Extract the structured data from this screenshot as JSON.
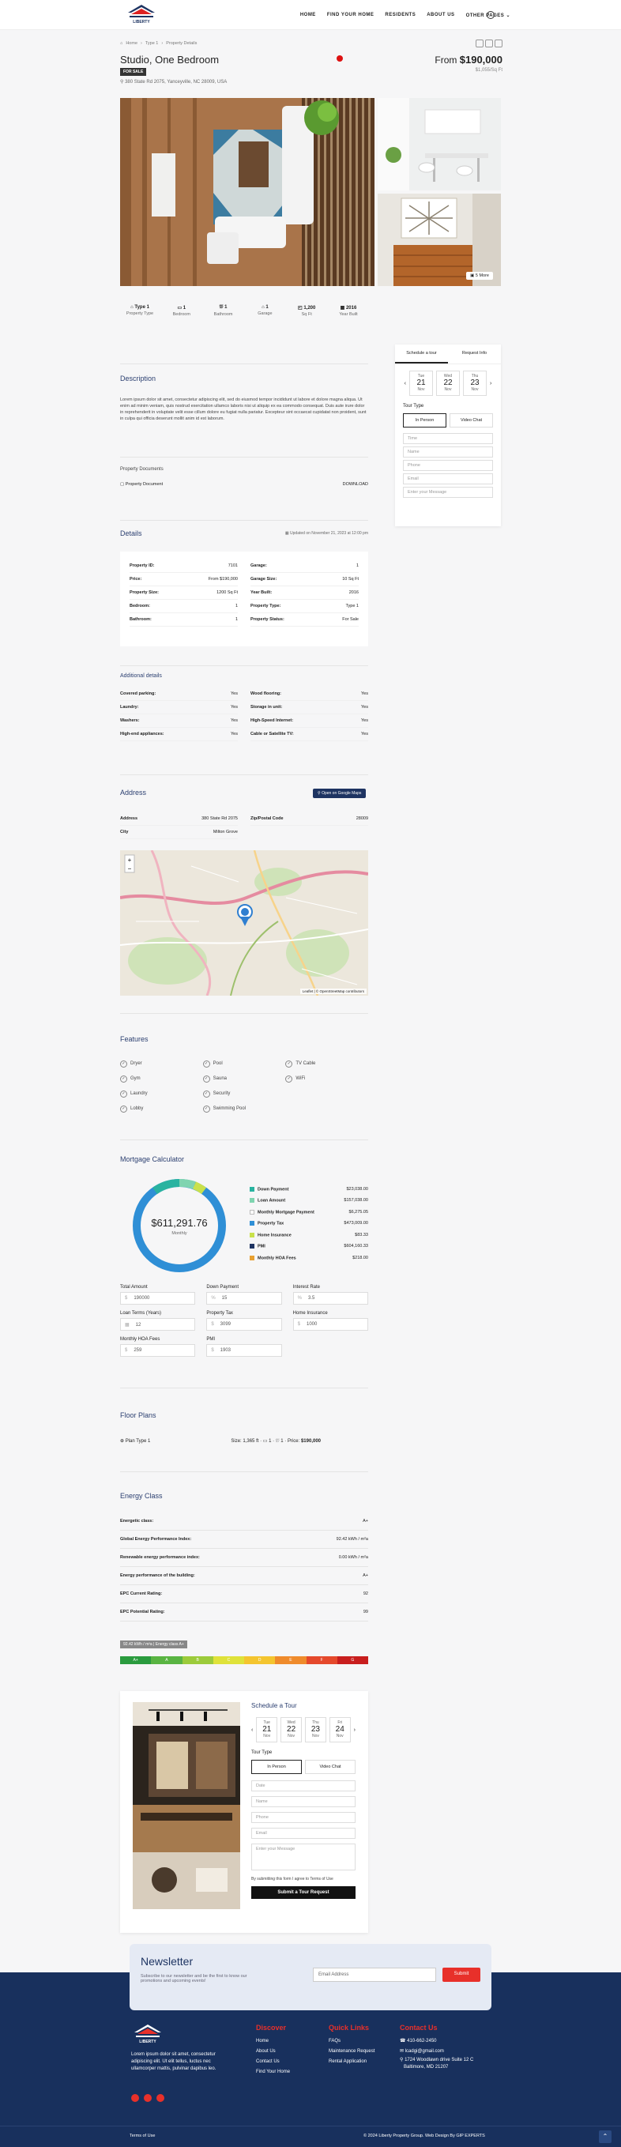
{
  "header": {
    "logo_text": "LIBERTY",
    "nav": [
      "HOME",
      "FIND YOUR HOME",
      "RESIDENTS",
      "ABOUT US",
      "OTHER PAGES"
    ]
  },
  "breadcrumb": [
    "Home",
    "Type 1",
    "Property Details"
  ],
  "property": {
    "title": "Studio, One Bedroom",
    "badge": "FOR SALE",
    "address": "380 State Rd 2075, Yanceyville, NC 28009, USA",
    "price_prefix": "From",
    "price": "$190,000",
    "price_sub": "$1,055/Sq Ft",
    "more_photos": "5 More"
  },
  "facts": [
    {
      "v": "Type 1",
      "l": "Property Type"
    },
    {
      "v": "1",
      "l": "Bedroom"
    },
    {
      "v": "1",
      "l": "Bathroom"
    },
    {
      "v": "1",
      "l": "Garage"
    },
    {
      "v": "1,200",
      "l": "Sq Ft"
    },
    {
      "v": "2016",
      "l": "Year Built"
    }
  ],
  "sidebar": {
    "tab1": "Schedule a tour",
    "tab2": "Request Info",
    "days": [
      {
        "d": "Tue",
        "n": "21",
        "m": "Nov"
      },
      {
        "d": "Wed",
        "n": "22",
        "m": "Nov"
      },
      {
        "d": "Thu",
        "n": "23",
        "m": "Nov"
      }
    ],
    "tour_type": "Tour Type",
    "in_person": "In Person",
    "video": "Video Chat",
    "fields": [
      "Time",
      "Name",
      "Phone",
      "Email",
      "Enter your Message"
    ]
  },
  "description": {
    "heading": "Description",
    "text": "Lorem ipsum dolor sit amet, consectetur adipiscing elit, sed do eiusmod tempor incididunt ut labore et dolore magna aliqua. Ut enim ad minim veniam, quis nostrud exercitation ullamco laboris nisi ut aliquip ex ea commodo consequat. Duis aute irure dolor in reprehenderit in voluptate velit esse cillum dolore eu fugiat nulla pariatur. Excepteur sint occaecat cupidatat non proident, sunt in culpa qui officia deserunt mollit anim id est laborum.",
    "docs_heading": "Property Documents",
    "doc_name": "Property Document",
    "download": "DOWNLOAD"
  },
  "details": {
    "heading": "Details",
    "updated": "Updated on November 21, 2023 at 12:00 pm",
    "left": [
      [
        "Property ID:",
        "7101"
      ],
      [
        "Price:",
        "From $190,000"
      ],
      [
        "Property Size:",
        "1200 Sq Ft"
      ],
      [
        "Bedroom:",
        "1"
      ],
      [
        "Bathroom:",
        "1"
      ]
    ],
    "right": [
      [
        "Garage:",
        "1"
      ],
      [
        "Garage Size:",
        "10 Sq Ft"
      ],
      [
        "Year Built:",
        "2016"
      ],
      [
        "Property Type:",
        "Type 1"
      ],
      [
        "Property Status:",
        "For Sale"
      ]
    ]
  },
  "additional": {
    "heading": "Additional details",
    "left": [
      [
        "Covered parking:",
        "Yes"
      ],
      [
        "Laundry:",
        "Yes"
      ],
      [
        "Washers:",
        "Yes"
      ],
      [
        "High-end appliances:",
        "Yes"
      ]
    ],
    "right": [
      [
        "Wood flooring:",
        "Yes"
      ],
      [
        "Storage in unit:",
        "Yes"
      ],
      [
        "High-Speed Internet:",
        "Yes"
      ],
      [
        "Cable or Satellite TV:",
        "Yes"
      ]
    ]
  },
  "address_sec": {
    "heading": "Address",
    "button": "Open on Google Maps",
    "rows": [
      [
        "Address",
        "380 State Rd 2075",
        "Zip/Postal Code",
        "28009"
      ],
      [
        "City",
        "Milton Grove",
        "",
        ""
      ]
    ],
    "map_credit": "Leaflet | © OpenStreetMap contributors"
  },
  "features": {
    "heading": "Features",
    "items": [
      "Dryer",
      "Pool",
      "TV Cable",
      "Gym",
      "Sauna",
      "WiFi",
      "Laundry",
      "Security",
      "",
      "Lobby",
      "Swimming Pool",
      ""
    ]
  },
  "mortgage": {
    "heading": "Mortgage Calculator",
    "total": "$611,291.76",
    "total_label": "Monthly",
    "rows": [
      [
        "Down Payment",
        "$23,038.00"
      ],
      [
        "Loan Amount",
        "$157,038.00"
      ],
      [
        "Monthly Mortgage Payment",
        "$6,275.05"
      ],
      [
        "Property Tax",
        "$473,009.00"
      ],
      [
        "Home Insurance",
        "$83.33"
      ],
      [
        "PMI",
        "$604,160.33"
      ],
      [
        "Monthly HOA Fees",
        "$218.00"
      ]
    ],
    "inputs": [
      {
        "l": "Total Amount",
        "p": "$",
        "v": "190000"
      },
      {
        "l": "Down Payment",
        "p": "%",
        "v": "15"
      },
      {
        "l": "Interest Rate",
        "p": "%",
        "v": "3.5"
      },
      {
        "l": "Loan Terms (Years)",
        "p": "▦",
        "v": "12"
      },
      {
        "l": "Property Tax",
        "p": "$",
        "v": "3099"
      },
      {
        "l": "Home Insurance",
        "p": "$",
        "v": "1000"
      },
      {
        "l": "Monthly HOA Fees",
        "p": "$",
        "v": "259"
      },
      {
        "l": "PMI",
        "p": "$",
        "v": "1903"
      }
    ]
  },
  "floor": {
    "heading": "Floor Plans",
    "name": "Plan Type 1",
    "size": "Size: 1,365 ft",
    "beds": "1",
    "baths": "1",
    "price_label": "Price:",
    "price": "$190,000"
  },
  "energy": {
    "heading": "Energy Class",
    "rows": [
      [
        "Energetic class:",
        "A+"
      ],
      [
        "Global Energy Performance Index:",
        "92.42 kWh / m²a"
      ],
      [
        "Renewable energy performance index:",
        "0.00 kWh / m²a"
      ],
      [
        "Energy performance of the building:",
        "A+"
      ],
      [
        "EPC Current Rating:",
        "92"
      ],
      [
        "EPC Potential Rating:",
        "99"
      ]
    ],
    "tag": "92.42 kWh / m²a | Energy class A+",
    "scale": [
      "A+",
      "A",
      "B",
      "C",
      "D",
      "E",
      "F",
      "G"
    ]
  },
  "tour": {
    "heading": "Schedule a Tour",
    "days": [
      {
        "d": "Tue",
        "n": "21",
        "m": "Nov"
      },
      {
        "d": "Wed",
        "n": "22",
        "m": "Nov"
      },
      {
        "d": "Thu",
        "n": "23",
        "m": "Nov"
      },
      {
        "d": "Fri",
        "n": "24",
        "m": "Nov"
      }
    ],
    "tour_type": "Tour Type",
    "in_person": "In Person",
    "video": "Video Chat",
    "fields": [
      "Date",
      "Name",
      "Phone",
      "Email",
      "Enter your Message"
    ],
    "terms": "By submitting this form I agree to Terms of Use",
    "submit": "Submit a Tour Request"
  },
  "newsletter": {
    "heading": "Newsletter",
    "text": "Subscribe to our newsletter and be the first to know our promotions and upcoming events!",
    "placeholder": "Email Address",
    "button": "Submit"
  },
  "footer": {
    "about": "Lorem ipsum dolor sit amet, consectetur adipiscing elit. Ut elit tellus, luctus nec ullamcorper mattis, pulvinar dapibus leo.",
    "col1": {
      "h": "Discover",
      "items": [
        "Home",
        "About Us",
        "Contact Us",
        "Find Your Home"
      ]
    },
    "col2": {
      "h": "Quick Links",
      "items": [
        "FAQs",
        "Maintenance Request",
        "Rental Application"
      ]
    },
    "col3": {
      "h": "Contact Us",
      "phone": "410-662-2450",
      "email": "lcadgi@gmail.com",
      "addr1": "1724 Woodlawn drive Suite 12 C",
      "addr2": "Baltimore, MD 21207"
    },
    "terms": "Terms of Use",
    "copyright": "© 2024 Liberty Property Group. Web Design By GIP EXPERTS"
  },
  "colors": {
    "navy": "#18305d",
    "red": "#e8302a",
    "donut": "#2f8fd6"
  }
}
